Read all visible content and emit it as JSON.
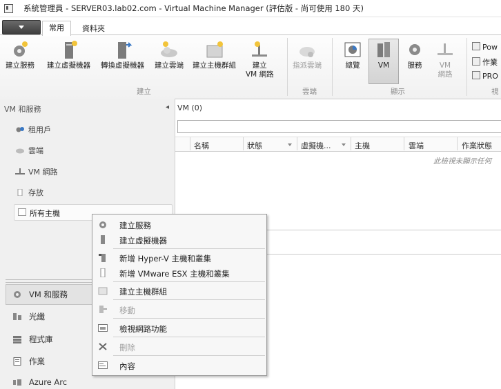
{
  "window": {
    "title": "系統管理員 - SERVER03.lab02.com - Virtual Machine Manager (評估版 - 尚可使用 180 天)"
  },
  "tabs": {
    "home": "常用",
    "folder": "資料夾"
  },
  "ribbon": {
    "create_service": "建立服務",
    "create_vm": "建立虛擬機器",
    "convert_vm": "轉換虛擬機器",
    "create_cloud": "建立雲端",
    "create_host_group": "建立主機群組",
    "create_vm_network_1": "建立",
    "create_vm_network_2": "VM 網路",
    "assign_cloud": "指派雲端",
    "overview": "總覽",
    "vm": "VM",
    "services": "服務",
    "vm_networks_1": "VM",
    "vm_networks_2": "網路",
    "group_create": "建立",
    "group_cloud": "雲端",
    "group_show": "顯示",
    "group_window": "視",
    "small_power": "Pow",
    "small_jobs": "作業",
    "small_pro": "PRO"
  },
  "left_pane": {
    "header": "VM 和服務",
    "collapse": "◂",
    "items": [
      "租用戶",
      "雲端",
      "VM 網路",
      "存放",
      "所有主機"
    ]
  },
  "workspaces": [
    "VM 和服務",
    "光纖",
    "程式庫",
    "作業",
    "Azure Arc"
  ],
  "main_pane": {
    "header": "VM (0)",
    "columns": [
      "名稱",
      "狀態",
      "虛擬機...",
      "主機",
      "雲端",
      "作業狀態"
    ],
    "empty_message": "此檢視未顯示任何"
  },
  "context_menu": {
    "items": [
      {
        "label": "建立服務",
        "disabled": false
      },
      {
        "label": "建立虛擬機器",
        "disabled": false
      },
      {
        "label": "新增 Hyper-V 主機和叢集",
        "disabled": false
      },
      {
        "label": "新增 VMware ESX 主機和叢集",
        "disabled": false
      },
      {
        "label": "建立主機群組",
        "disabled": false
      },
      {
        "label": "移動",
        "disabled": true
      },
      {
        "label": "檢視網路功能",
        "disabled": false
      },
      {
        "label": "刪除",
        "disabled": true
      },
      {
        "label": "內容",
        "disabled": false
      }
    ]
  },
  "colors": {
    "accent_blue": "#3a78c4",
    "ribbon_bg": "#f4f4f4",
    "left_pane_bg": "#f0f0f0"
  }
}
